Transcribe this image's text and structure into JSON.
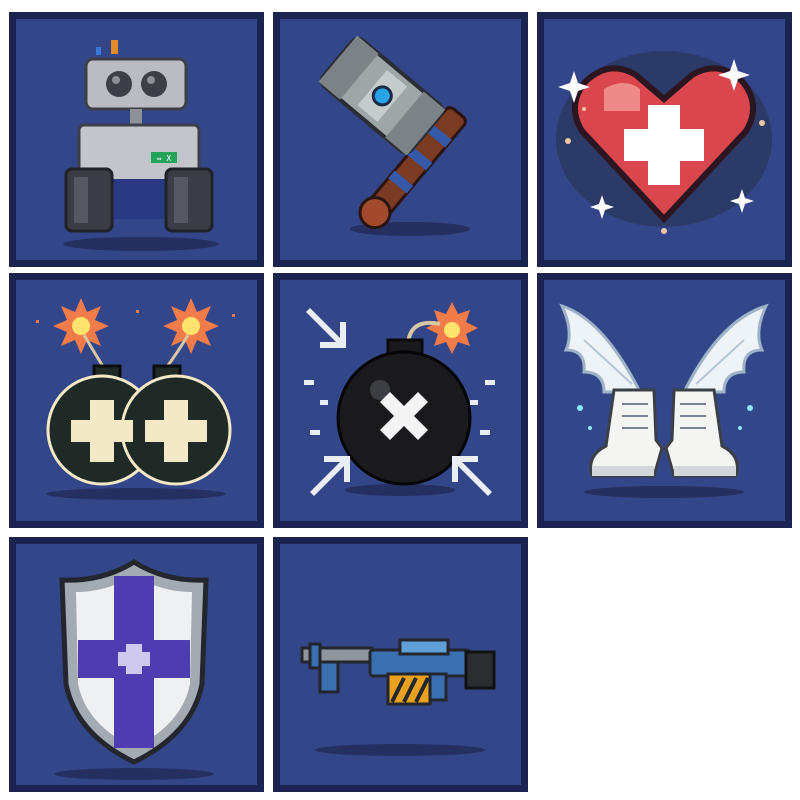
{
  "inventory": {
    "items": [
      {
        "icon": "robot-drone-icon"
      },
      {
        "icon": "war-hammer-icon"
      },
      {
        "icon": "health-heart-icon"
      },
      {
        "icon": "double-bomb-icon"
      },
      {
        "icon": "bomb-icon"
      },
      {
        "icon": "winged-boots-icon"
      },
      {
        "icon": "cross-shield-icon"
      },
      {
        "icon": "blaster-gun-icon"
      }
    ],
    "robot_badge_text": "⇔ X"
  },
  "colors": {
    "tile_background": "#34468a",
    "tile_border": "#1b2350",
    "page_background": "#ffffff"
  }
}
